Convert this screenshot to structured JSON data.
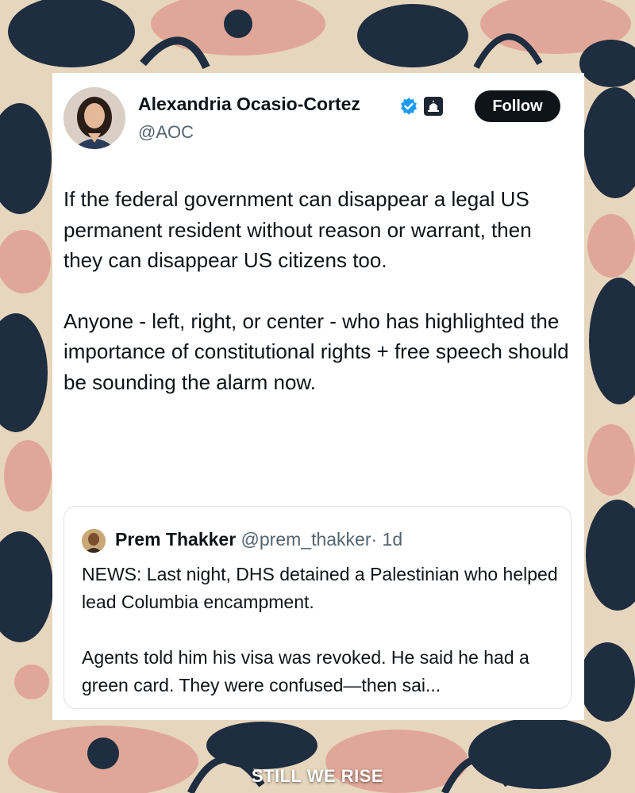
{
  "colors": {
    "text_primary": "#0f1419",
    "text_secondary": "#536471",
    "verified_blue": "#1d9bf0",
    "follow_button": "#0f1419",
    "pattern_navy": "#1e2d40",
    "pattern_pink": "#e0a798"
  },
  "tweet": {
    "author_name": "Alexandria Ocasio-Cortez",
    "author_handle": "@AOC",
    "badges": [
      "verified-checkmark-icon",
      "government-capitol-icon"
    ],
    "follow_label": "Follow",
    "paragraphs": [
      "If the federal government can disappear a legal US permanent resident without reason or warrant, then they can disappear US citizens too.",
      "Anyone - left, right, or center - who has highlighted the importance of constitutional rights + free speech should be sounding the alarm now."
    ]
  },
  "quoted_tweet": {
    "author_name": "Prem Thakker",
    "author_handle": "@prem_thakker",
    "time": "· 1d",
    "paragraphs": [
      "NEWS: Last night, DHS detained a Palestinian who helped lead Columbia encampment.",
      "Agents told him his visa was revoked. He said he had a green card. They were confused—then sai..."
    ]
  },
  "watermark": "STILL WE RISE"
}
